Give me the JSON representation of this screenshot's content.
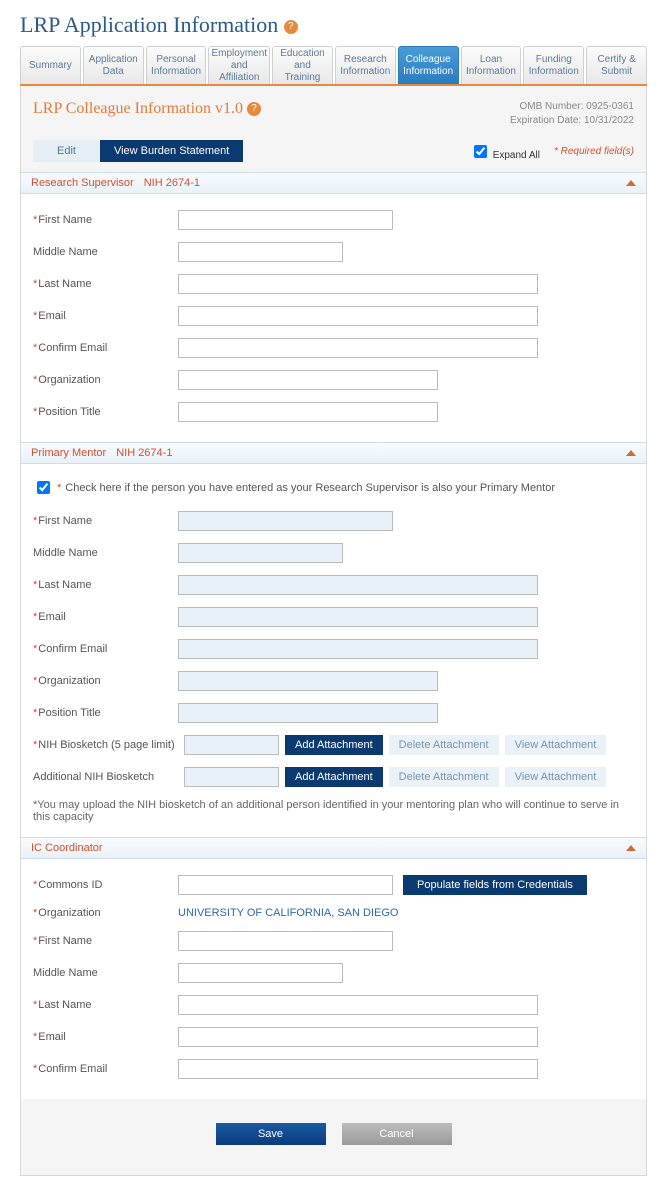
{
  "page_title": "LRP Application Information",
  "tabs": [
    {
      "label": "Summary"
    },
    {
      "label": "Application Data"
    },
    {
      "label": "Personal Information"
    },
    {
      "label": "Employment and Affiliation"
    },
    {
      "label": "Education and Training"
    },
    {
      "label": "Research Information"
    },
    {
      "label": "Colleague Information"
    },
    {
      "label": "Loan Information"
    },
    {
      "label": "Funding Information"
    },
    {
      "label": "Certify & Submit"
    }
  ],
  "active_tab_index": 6,
  "card": {
    "title": "LRP Colleague Information v1.0",
    "omb_number": "OMB Number: 0925-0361",
    "expiration": "Expiration Date: 10/31/2022",
    "edit_label": "Edit",
    "burden_label": "View Burden Statement",
    "expand_all_label": "Expand All",
    "expand_all_checked": true,
    "required_note": "* Required field(s)"
  },
  "sections": {
    "supervisor": {
      "title": "Research Supervisor",
      "nih": "NIH 2674-1",
      "fields": {
        "first_name": "First Name",
        "middle_name": "Middle Name",
        "last_name": "Last Name",
        "email": "Email",
        "confirm_email": "Confirm Email",
        "organization": "Organization",
        "position_title": "Position Title"
      }
    },
    "mentor": {
      "title": "Primary Mentor",
      "nih": "NIH 2674-1",
      "checkbox_label": "Check here if the person you have entered as your Research Supervisor is also your Primary Mentor",
      "checkbox_checked": true,
      "fields": {
        "first_name": "First Name",
        "middle_name": "Middle Name",
        "last_name": "Last Name",
        "email": "Email",
        "confirm_email": "Confirm Email",
        "organization": "Organization",
        "position_title": "Position Title",
        "biosketch": "NIH Biosketch (5 page limit)",
        "add_biosketch": "Additional NIH Biosketch"
      },
      "buttons": {
        "add": "Add Attachment",
        "delete": "Delete Attachment",
        "view": "View Attachment"
      },
      "note": "*You may upload the NIH biosketch of an additional person identified in your mentoring plan who will continue to serve in this capacity"
    },
    "ic": {
      "title": "IC Coordinator",
      "populate_label": "Populate fields from Credentials",
      "org_value": "UNIVERSITY OF CALIFORNIA, SAN DIEGO",
      "fields": {
        "commons_id": "Commons ID",
        "organization": "Organization",
        "first_name": "First Name",
        "middle_name": "Middle Name",
        "last_name": "Last Name",
        "email": "Email",
        "confirm_email": "Confirm Email"
      }
    }
  },
  "footer": {
    "save": "Save",
    "cancel": "Cancel"
  }
}
